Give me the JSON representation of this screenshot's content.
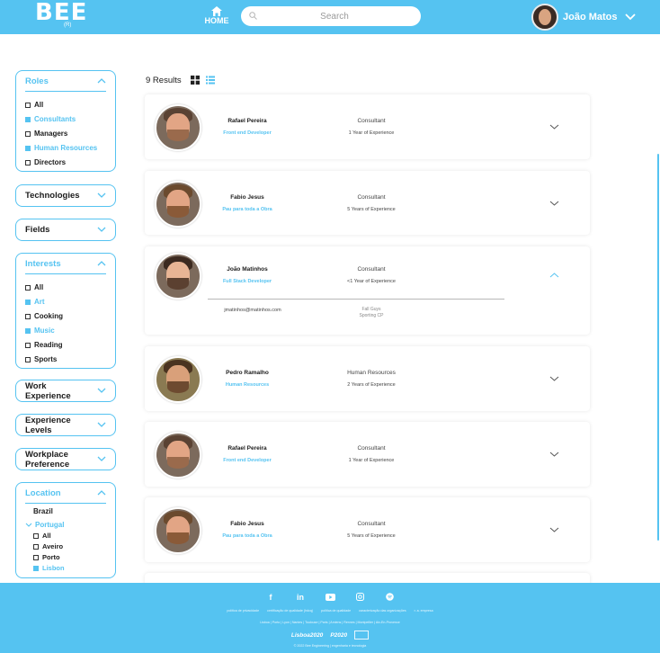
{
  "header": {
    "logo": "BEE",
    "logo_sub": "(R)",
    "home_label": "HOME",
    "search_placeholder": "Search",
    "user_name": "João Matos"
  },
  "filters": {
    "roles": {
      "title": "Roles",
      "options": [
        {
          "label": "All",
          "selected": false
        },
        {
          "label": "Consultants",
          "selected": true
        },
        {
          "label": "Managers",
          "selected": false
        },
        {
          "label": "Human Resources",
          "selected": true
        },
        {
          "label": "Directors",
          "selected": false
        }
      ]
    },
    "technologies": {
      "title": "Technologies"
    },
    "fields": {
      "title": "Fields"
    },
    "interests": {
      "title": "Interests",
      "options": [
        {
          "label": "All",
          "selected": false
        },
        {
          "label": "Art",
          "selected": true
        },
        {
          "label": "Cooking",
          "selected": false
        },
        {
          "label": "Music",
          "selected": true
        },
        {
          "label": "Reading",
          "selected": false
        },
        {
          "label": "Sports",
          "selected": false
        }
      ]
    },
    "work_experience": {
      "title_line1": "Work",
      "title_line2": "Experience"
    },
    "experience_levels": {
      "title_line1": "Experience",
      "title_line2": "Levels"
    },
    "workplace_preference": {
      "title_line1": "Workplace",
      "title_line2": "Preference"
    },
    "location": {
      "title": "Location",
      "brazil": "Brazil",
      "portugal": "Portugal",
      "options": [
        {
          "label": "All",
          "selected": false
        },
        {
          "label": "Aveiro",
          "selected": false
        },
        {
          "label": "Porto",
          "selected": false
        },
        {
          "label": "Lisbon",
          "selected": true
        }
      ]
    }
  },
  "results": {
    "count_label": "9 Results",
    "view_grid_icon": "grid-view-icon",
    "view_list_icon": "list-view-icon"
  },
  "people": [
    {
      "name": "Rafael Pereira",
      "role": "Front end Developer",
      "title": "Consultant",
      "experience": "1 Year of Experience",
      "expanded": false
    },
    {
      "name": "Fabio Jesus",
      "role": "Pau para toda a Obra",
      "title": "Consultant",
      "experience": "5 Years of Experience",
      "expanded": false
    },
    {
      "name": "João Matinhos",
      "role": "Full Stack Developer",
      "title": "Consultant",
      "experience": "<1 Year of Experience",
      "expanded": true,
      "email": "jmatinhos@matinhos.com",
      "extra_1": "Fall Guys",
      "extra_2": "Sporting CP"
    },
    {
      "name": "Pedro Ramalho",
      "role": "Human Resources",
      "title": "Human Resources",
      "experience": "2 Years of Experience",
      "expanded": false
    },
    {
      "name": "Rafael Pereira",
      "role": "Front end Developer",
      "title": "Consultant",
      "experience": "1 Year of Experience",
      "expanded": false
    },
    {
      "name": "Fabio Jesus",
      "role": "Pau para toda a Obra",
      "title": "Consultant",
      "experience": "5 Years of Experience",
      "expanded": false
    }
  ],
  "footer": {
    "socials": [
      "f",
      "in",
      "yt",
      "ig",
      "sp"
    ],
    "links": [
      "política de privacidade",
      "certificação de qualidade (hdcq)",
      "política de qualidade",
      "caracterização das organizações",
      "r. a. empresa"
    ],
    "cities": "Lisboa | Porto | Lyon | Nantes | Toulouse | Paris | Amiens | Rennes | Montpellier | Aix-En-Provence",
    "logos": [
      "Lisboa2020",
      "P2020"
    ],
    "copyright": "© 2022 Bee Engineering | engenharia e tecnologia"
  },
  "colors": {
    "accent": "#55c3f1",
    "text": "#1b1b1b",
    "muted": "#444444"
  }
}
